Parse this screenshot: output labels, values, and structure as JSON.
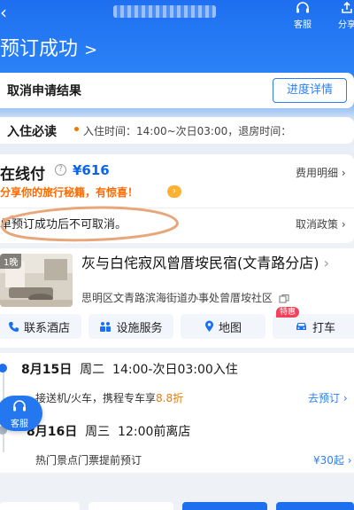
{
  "header": {
    "title": "预订成功",
    "title_chevron": ">",
    "customer_service_label": "客服",
    "share_label": "分享"
  },
  "cancel_result": {
    "label": "取消申请结果",
    "progress_button": "进度详情"
  },
  "checkin_notice": {
    "label": "入住必读",
    "text": "入住时间：14:00~次日03:00，退房时间："
  },
  "payment": {
    "method": "在线付",
    "help_icon": "question-circle-icon",
    "amount": "¥616",
    "fee_detail_link": "费用明细",
    "promo_text": "分享你的旅行秘籍，有惊喜！",
    "non_cancel_text": "单预订成功后不可取消。",
    "cancel_policy_link": "取消政策"
  },
  "hotel": {
    "nights_badge": "1晚",
    "name": "灰与白侘寂风曾厝垵民宿(文青路分店)",
    "address": "思明区文青路滨海街道办事处曾厝垵社区",
    "actions": [
      {
        "label": "联系酒店",
        "icon": "phone-icon"
      },
      {
        "label": "设施服务",
        "icon": "facilities-icon"
      },
      {
        "label": "地图",
        "icon": "map-pin-icon"
      },
      {
        "label": "打车",
        "icon": "car-icon"
      }
    ],
    "special_badge": "特惠"
  },
  "timeline": {
    "checkin_date": "8月15日",
    "checkin_weekday": "周二",
    "checkin_time": "14:00-次日03:00入住",
    "pickup_text": "接送机/火车，携程专车享",
    "pickup_discount": "8.8折",
    "pickup_link": "去预订",
    "checkout_date": "8月16日",
    "checkout_weekday": "周三",
    "checkout_time": "12:00前离店",
    "tickets_text": "热门景点门票提前预订",
    "tickets_price": "¥30起"
  },
  "floating_service": {
    "label": "客服"
  },
  "colors": {
    "brand_blue": "#1e6ff0",
    "price_blue": "#0b65e8",
    "promo_orange": "#ff6a00",
    "scribble": "#e8a77a"
  }
}
